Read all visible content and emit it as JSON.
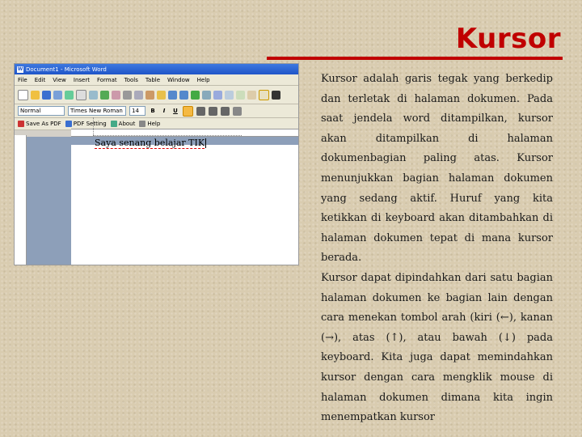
{
  "slide": {
    "title": "Kursor",
    "accent_color": "#c00000",
    "paragraphs": [
      "Kursor adalah garis tegak yang berkedip dan terletak di halaman dokumen. Pada saat jendela word ditampilkan, kursor akan ditampilkan di halaman dokumenbagian paling atas. Kursor menunjukkan bagian halaman dokumen yang sedang aktif. Huruf yang kita ketikkan di keyboard akan ditambahkan di halaman dokumen tepat di mana kursor berada.",
      "Kursor dapat dipindahkan dari satu bagian halaman dokumen ke bagian lain dengan cara menekan tombol arah (kiri (←), kanan (→), atas (↑), atau bawah (↓) pada keyboard. Kita juga dapat memindahkan kursor dengan cara mengklik mouse di halaman dokumen dimana kita ingin menempatkan kursor"
    ]
  },
  "word_window": {
    "title": "Document1 - Microsoft Word",
    "menu": [
      "File",
      "Edit",
      "View",
      "Insert",
      "Format",
      "Tools",
      "Table",
      "Window",
      "Help"
    ],
    "style_value": "Normal",
    "font_value": "Times New Roman",
    "size_value": "14",
    "format_buttons": [
      "B",
      "I",
      "U"
    ],
    "pdf_toolbar": [
      "Save As PDF",
      "PDF Setting",
      "About",
      "Help"
    ],
    "document_text": "Saya senang belajar TIK"
  }
}
